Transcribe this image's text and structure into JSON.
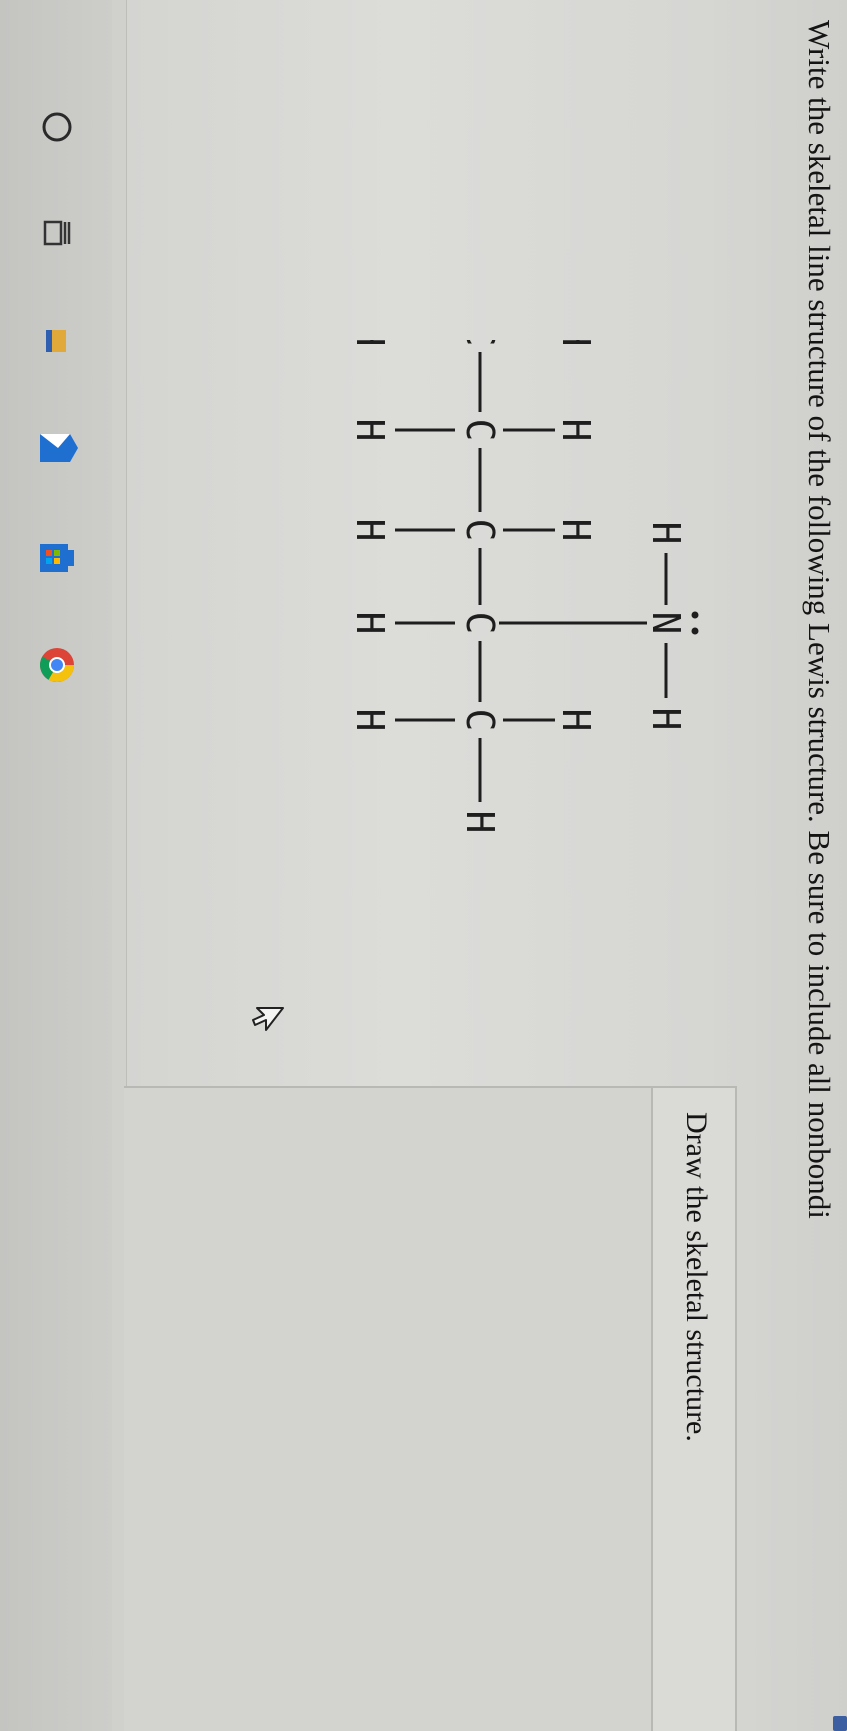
{
  "question": {
    "instruction": "Write the skeletal line structure of the following Lewis structure. Be sure to include all nonbondi"
  },
  "lewis_structure": {
    "atoms": {
      "hydrogen": "H",
      "carbon": "C",
      "nitrogen": "N"
    }
  },
  "drawing_panel": {
    "label": "Draw the skeletal structure."
  },
  "taskbar": {
    "items": [
      "start-button",
      "task-view-button",
      "file-explorer-button",
      "mail-button",
      "store-button",
      "chrome-button"
    ]
  },
  "colors": {
    "text": "#141414",
    "screen_bg": "#d4d4d1",
    "bezel": "#1b1d22",
    "mail_blue": "#1f6fd1",
    "folder_yellow": "#e0a93a"
  }
}
